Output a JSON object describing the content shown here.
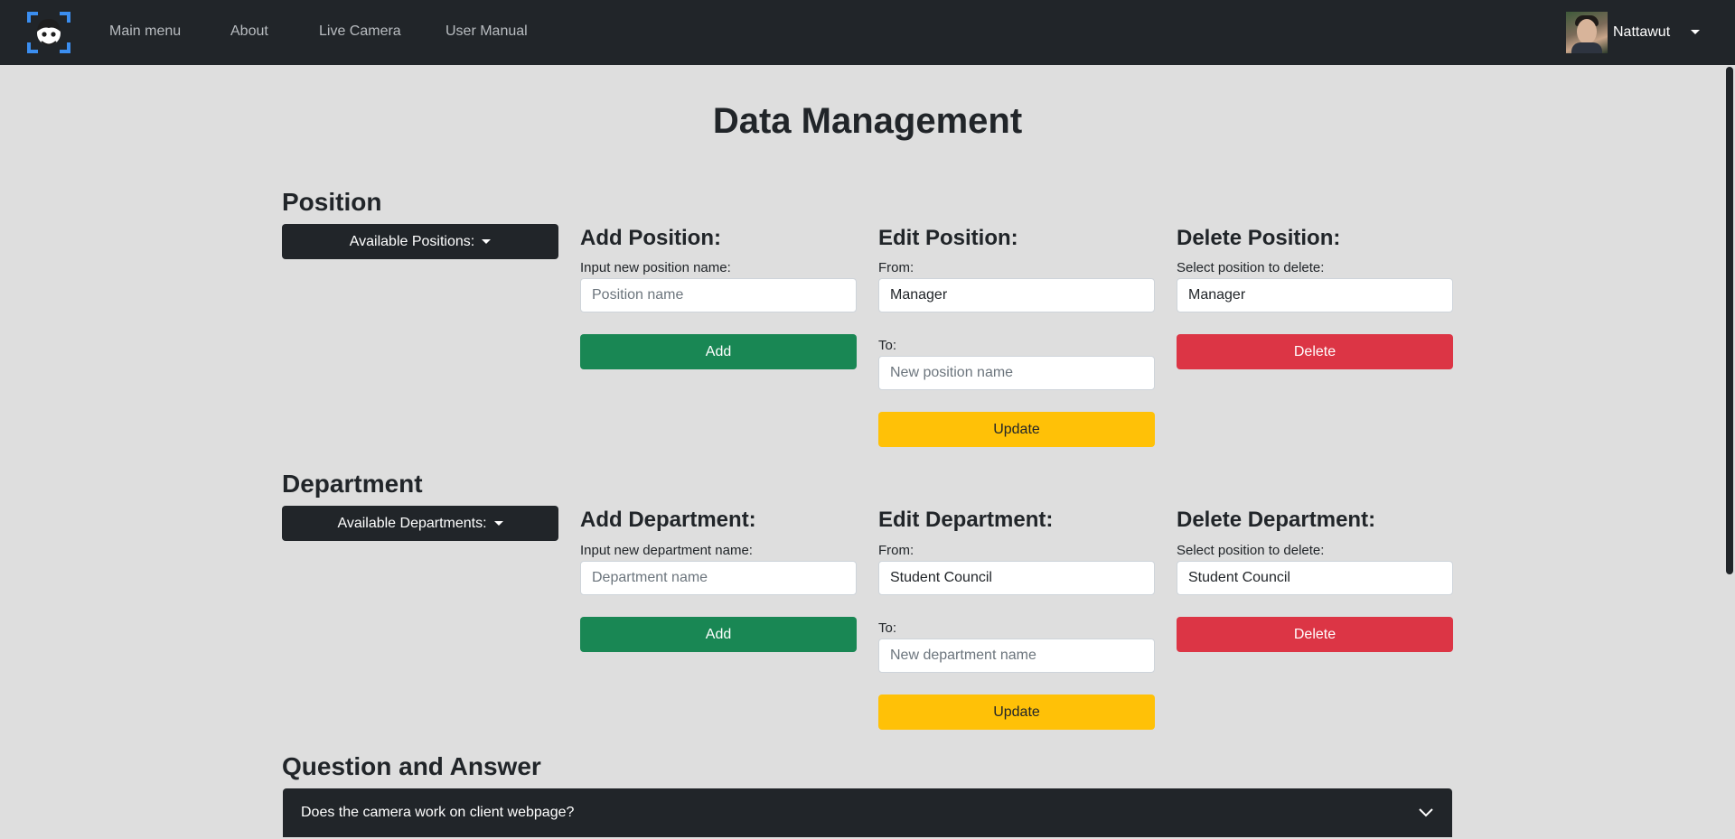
{
  "navbar": {
    "logo_icon": "face-scan-logo-icon",
    "links": [
      "Main menu",
      "About",
      "Live Camera",
      "User Manual"
    ],
    "user": {
      "name": "Nattawut",
      "avatar_icon": "user-avatar-photo"
    }
  },
  "page": {
    "title": "Data Management"
  },
  "position": {
    "title": "Position",
    "dropdown_label": "Available Positions:",
    "add": {
      "heading": "Add Position:",
      "label": "Input new position name:",
      "placeholder": "Position name",
      "button": "Add"
    },
    "edit": {
      "heading": "Edit Position:",
      "from_label": "From:",
      "from_value": "Manager",
      "to_label": "To:",
      "to_placeholder": "New position name",
      "button": "Update"
    },
    "delete": {
      "heading": "Delete Position:",
      "label": "Select position to delete:",
      "value": "Manager",
      "button": "Delete"
    }
  },
  "department": {
    "title": "Department",
    "dropdown_label": "Available Departments:",
    "add": {
      "heading": "Add Department:",
      "label": "Input new department name:",
      "placeholder": "Department name",
      "button": "Add"
    },
    "edit": {
      "heading": "Edit Department:",
      "from_label": "From:",
      "from_value": "Student Council",
      "to_label": "To:",
      "to_placeholder": "New department name",
      "button": "Update"
    },
    "delete": {
      "heading": "Delete Department:",
      "label": "Select position to delete:",
      "value": "Student Council",
      "button": "Delete"
    }
  },
  "qa": {
    "title": "Question and Answer",
    "items": [
      {
        "question": "Does the camera work on client webpage?",
        "icon": "chevron-down-icon"
      }
    ]
  },
  "colors": {
    "navbar": "#212529",
    "background": "#dedede",
    "add": "#198754",
    "update": "#ffc107",
    "delete": "#dc3545",
    "logo_accent": "#3b8ef0"
  }
}
